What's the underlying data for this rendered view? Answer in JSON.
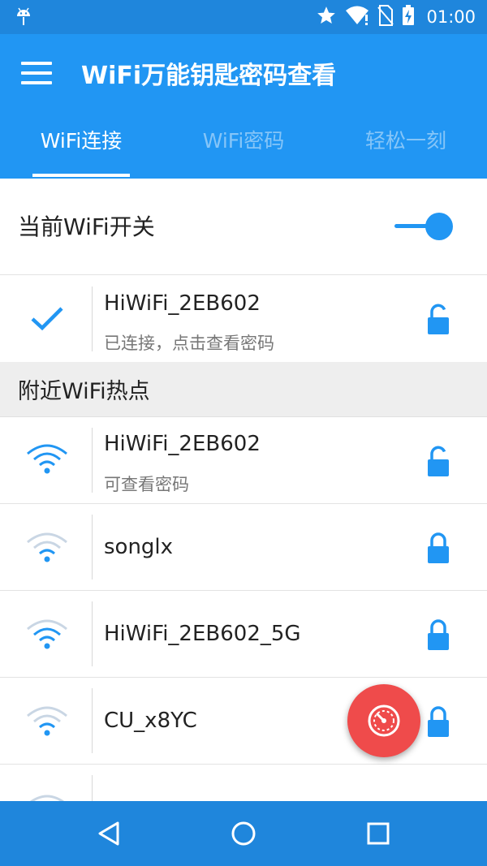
{
  "status_bar": {
    "time": "01:00"
  },
  "app_bar": {
    "title": "WiFi万能钥匙密码查看"
  },
  "tabs": [
    {
      "label": "WiFi连接",
      "active": true
    },
    {
      "label": "WiFi密码",
      "active": false
    },
    {
      "label": "轻松一刻",
      "active": false
    }
  ],
  "wifi_switch": {
    "label": "当前WiFi开关",
    "on": true
  },
  "connected": {
    "ssid": "HiWiFi_2EB602",
    "status": "已连接，点击查看密码",
    "lock": "unlock-icon"
  },
  "nearby": {
    "header": "附近WiFi热点",
    "items": [
      {
        "ssid": "HiWiFi_2EB602",
        "sub": "可查看密码",
        "signal": "strong",
        "lock": "unlock-icon"
      },
      {
        "ssid": "songlx",
        "sub": "",
        "signal": "weak",
        "lock": "lock-icon"
      },
      {
        "ssid": "HiWiFi_2EB602_5G",
        "sub": "",
        "signal": "medium",
        "lock": "lock-icon"
      },
      {
        "ssid": "CU_x8YC",
        "sub": "",
        "signal": "weak",
        "lock": "lock-icon"
      }
    ]
  },
  "colors": {
    "primary": "#2196f3",
    "primary_dark": "#1f86dc",
    "fab": "#ef4b4b"
  }
}
